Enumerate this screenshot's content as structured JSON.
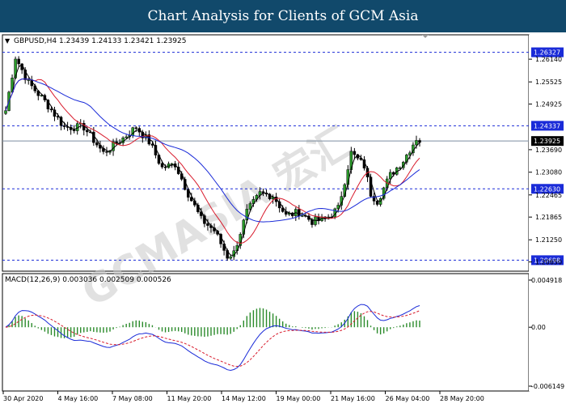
{
  "header": {
    "title": "Chart Analysis for Clients of GCM Asia"
  },
  "watermark": "GCMASIA 宏汇",
  "chart_data": [
    {
      "type": "candlestick",
      "symbol_info": "GBPUSD,H4  1.23439 1.24133 1.23421 1.23925",
      "price_ylim": [
        1.204,
        1.268
      ],
      "price_ticks": [
        "1.26140",
        "1.25525",
        "1.24925",
        "1.23690",
        "1.23080",
        "1.22465",
        "1.21865",
        "1.21250",
        "1.20650"
      ],
      "price_tick_values": [
        1.2614,
        1.25525,
        1.24925,
        1.2369,
        1.2308,
        1.22465,
        1.21865,
        1.2125,
        1.2065
      ],
      "levels": [
        {
          "label": "1.26327",
          "value": 1.26327
        },
        {
          "label": "1.24337",
          "value": 1.24337
        },
        {
          "label": "1.22630",
          "value": 1.2263
        },
        {
          "label": "1.20698",
          "value": 1.20698
        }
      ],
      "current_price": {
        "label": "1.23925",
        "value": 1.23925
      },
      "x_labels": [
        "30 Apr 2020",
        "4 May 16:00",
        "7 May 08:00",
        "11 May 20:00",
        "14 May 12:00",
        "19 May 00:00",
        "21 May 16:00",
        "26 May 04:00",
        "28 May 20:00"
      ],
      "close_path": [
        [
          0,
          1.2475
        ],
        [
          3,
          1.262
        ],
        [
          7,
          1.255
        ],
        [
          12,
          1.25
        ],
        [
          18,
          1.243
        ],
        [
          24,
          1.243
        ],
        [
          30,
          1.236
        ],
        [
          36,
          1.24
        ],
        [
          40,
          1.243
        ],
        [
          44,
          1.239
        ],
        [
          48,
          1.232
        ],
        [
          52,
          1.233
        ],
        [
          56,
          1.225
        ],
        [
          60,
          1.218
        ],
        [
          64,
          1.215
        ],
        [
          68,
          1.208
        ],
        [
          70,
          1.209
        ],
        [
          74,
          1.22
        ],
        [
          78,
          1.225
        ],
        [
          82,
          1.2245
        ],
        [
          86,
          1.219
        ],
        [
          90,
          1.22
        ],
        [
          94,
          1.2175
        ],
        [
          98,
          1.218
        ],
        [
          102,
          1.221
        ],
        [
          106,
          1.236
        ],
        [
          110,
          1.2325
        ],
        [
          112,
          1.225
        ],
        [
          114,
          1.223
        ],
        [
          118,
          1.23
        ],
        [
          122,
          1.234
        ],
        [
          126,
          1.24
        ],
        [
          127,
          1.2393
        ]
      ],
      "ma_colors": {
        "fast": "#000000",
        "mid": "#d81b2c",
        "slow": "#1a2bd8"
      },
      "macd": {
        "label": "MACD(12,26,9) 0.003036 0.002509 0.000526",
        "ylim": [
          -0.006149,
          0.004918
        ],
        "ticks": [
          "0.004918",
          "0.00",
          "-0.006149"
        ],
        "tick_values": [
          0.004918,
          0.0,
          -0.006149
        ],
        "histogram_color": "#2a8a2a",
        "macd_color": "#1a2bd8",
        "signal_color": "#d81b2c"
      }
    }
  ]
}
